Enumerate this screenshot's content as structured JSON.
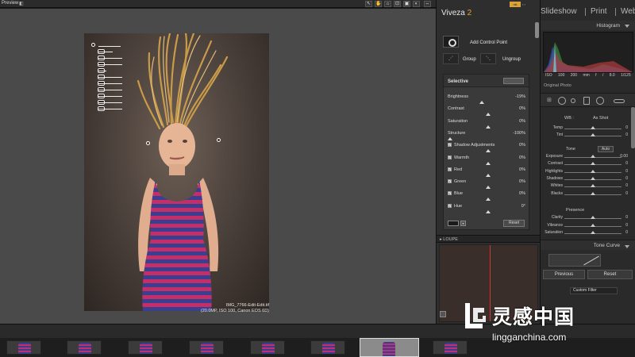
{
  "topbar": {
    "label": "Preview",
    "buttons": [
      "↖",
      "✋",
      "⌂",
      "⊡",
      "▣",
      "◐",
      "⇔"
    ]
  },
  "photo": {
    "filename": "IMG_7766-Edit-Edit.tif",
    "info": "(20.0MP, ISO 100, Canon EOS 6D)"
  },
  "viveza": {
    "title_main": "Viveza",
    "title_num": "2",
    "badge": "nik",
    "add_control_point": "Add Control Point",
    "group": "Group",
    "ungroup": "Ungroup",
    "selective": {
      "title": "Selective",
      "rows": [
        {
          "label": "Brightness",
          "value": "-19%",
          "checkbox": false,
          "marker": 0.42
        },
        {
          "label": "Contrast",
          "value": "0%",
          "checkbox": false,
          "marker": 0.5
        },
        {
          "label": "Saturation",
          "value": "0%",
          "checkbox": false,
          "marker": 0.5
        },
        {
          "label": "Structure",
          "value": "-100%",
          "checkbox": false,
          "marker": 0.0
        },
        {
          "label": "Shadow Adjustments",
          "value": "0%",
          "checkbox": true,
          "marker": 0.5
        },
        {
          "label": "Warmth",
          "value": "0%",
          "checkbox": true,
          "marker": 0.5
        },
        {
          "label": "Red",
          "value": "0%",
          "checkbox": true,
          "marker": 0.5
        },
        {
          "label": "Green",
          "value": "0%",
          "checkbox": true,
          "marker": 0.5
        },
        {
          "label": "Blue",
          "value": "0%",
          "checkbox": true,
          "marker": 0.5
        },
        {
          "label": "Hue",
          "value": "0°",
          "checkbox": true,
          "marker": 0.5
        }
      ],
      "reset": "Reset"
    },
    "loupe": "LOUPE"
  },
  "lightroom": {
    "modules": [
      "Slideshow",
      "Print",
      "Web"
    ],
    "histogram_title": "Histogram",
    "hist_stats": "ISO 100 200 mm f / 8.0 1/125 sec",
    "original_photo": "Original Photo",
    "wb_label": "WB :",
    "wb_value": "As Shot",
    "tone_label": "Tone",
    "auto": "Auto",
    "presence_label": "Presence",
    "rows_wb": [
      {
        "label": "Temp",
        "value": "0",
        "pos": 0.5
      },
      {
        "label": "Tint",
        "value": "0",
        "pos": 0.5
      }
    ],
    "rows_tone": [
      {
        "label": "Exposure",
        "value": "0.00",
        "pos": 0.5
      },
      {
        "label": "Contrast",
        "value": "0",
        "pos": 0.5
      },
      {
        "label": "Highlights",
        "value": "0",
        "pos": 0.5
      },
      {
        "label": "Shadows",
        "value": "0",
        "pos": 0.5
      },
      {
        "label": "Whites",
        "value": "0",
        "pos": 0.5
      },
      {
        "label": "Blacks",
        "value": "0",
        "pos": 0.5
      }
    ],
    "rows_presence": [
      {
        "label": "Clarity",
        "value": "0",
        "pos": 0.5
      },
      {
        "label": "Vibrance",
        "value": "0",
        "pos": 0.5
      },
      {
        "label": "Saturation",
        "value": "0",
        "pos": 0.5
      }
    ],
    "tone_curve": "Tone Curve",
    "previous": "Previous",
    "reset": "Reset",
    "custom_filter": "Custom Filter"
  },
  "watermark": {
    "cn": "灵感中国",
    "url": "lingganchina.com"
  },
  "colors": {
    "accent": "#f0a030",
    "loupe_line": "#d03838"
  }
}
